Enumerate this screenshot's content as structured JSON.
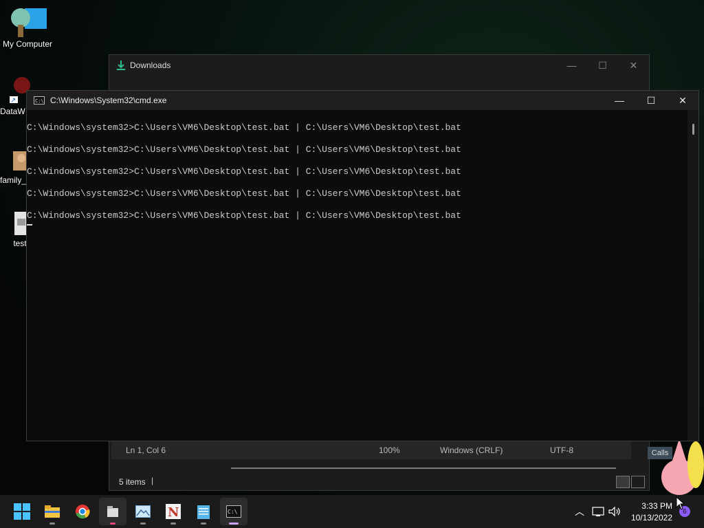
{
  "desktop": {
    "icons": [
      {
        "label": "My Computer"
      },
      {
        "label": "DataW"
      },
      {
        "label": "family_"
      },
      {
        "label": "test"
      }
    ]
  },
  "explorer": {
    "title": "Downloads",
    "items_count": "5 items",
    "notepad_status": {
      "position": "Ln 1, Col 6",
      "zoom": "100%",
      "line_endings": "Windows (CRLF)",
      "encoding": "UTF-8"
    }
  },
  "cmd": {
    "title": "C:\\Windows\\System32\\cmd.exe",
    "lines": [
      "C:\\Windows\\system32>C:\\Users\\VM6\\Desktop\\test.bat | C:\\Users\\VM6\\Desktop\\test.bat",
      "C:\\Windows\\system32>C:\\Users\\VM6\\Desktop\\test.bat | C:\\Users\\VM6\\Desktop\\test.bat",
      "C:\\Windows\\system32>C:\\Users\\VM6\\Desktop\\test.bat | C:\\Users\\VM6\\Desktop\\test.bat",
      "C:\\Windows\\system32>C:\\Users\\VM6\\Desktop\\test.bat | C:\\Users\\VM6\\Desktop\\test.bat",
      "C:\\Windows\\system32>C:\\Users\\VM6\\Desktop\\test.bat | C:\\Users\\VM6\\Desktop\\test.bat"
    ]
  },
  "side_badge": "Calls",
  "taskbar": {
    "time": "3:33 PM",
    "date": "10/13/2022",
    "notification_count": "6"
  }
}
